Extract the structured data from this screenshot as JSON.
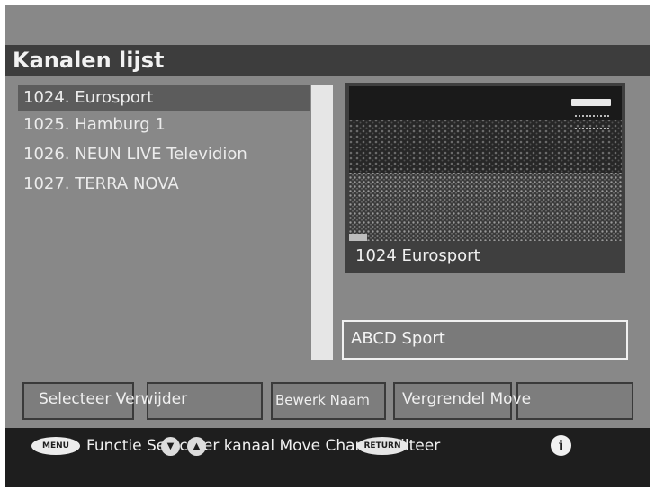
{
  "title": "Kanalen lijst",
  "channels": [
    {
      "label": "1024. Eurosport",
      "selected": true
    },
    {
      "label": "1025. Hamburg 1",
      "selected": false
    },
    {
      "label": "1026. NEUN LIVE Televidion",
      "selected": false
    },
    {
      "label": "1027. TERRA NOVA",
      "selected": false
    }
  ],
  "preview": {
    "caption": "1024 Eurosport"
  },
  "info_box": {
    "text": "ABCD Sport"
  },
  "function_buttons": {
    "select_delete": "Selecteer Verwijder",
    "edit_name": "Bewerk Naam",
    "lock_move": "Vergrendel Move"
  },
  "status_bar": {
    "menu_key": "MENU",
    "return_key": "RETURN",
    "text": "Functie Selecteer kanaal Move Channel Filteer",
    "info_icon": "info-icon"
  },
  "colors": {
    "screen_bg": "#888888",
    "title_bar_bg": "#3d3d3d",
    "selected_item_bg": "#5c5c5c",
    "status_bar_bg": "#1e1e1e"
  }
}
